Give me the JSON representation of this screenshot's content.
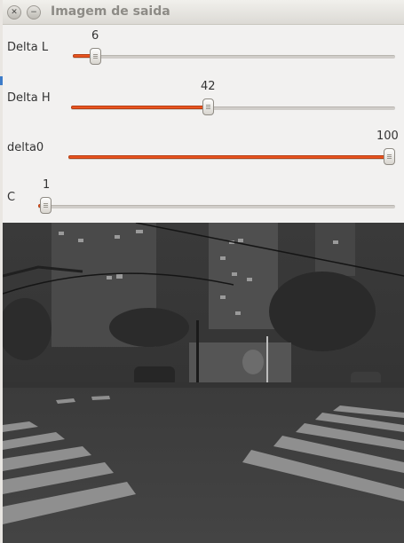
{
  "window": {
    "title": "Imagem de saida",
    "close_icon": "close-icon",
    "minimize_icon": "minimize-icon"
  },
  "sliders": [
    {
      "label": "Delta L",
      "value": "6",
      "max": 100,
      "level": 0.06
    },
    {
      "label": "Delta H",
      "value": "42",
      "max": 100,
      "level": 0.42
    },
    {
      "label": "delta0",
      "value": "100",
      "max": 100,
      "level": 1.0
    },
    {
      "label": "C",
      "value": "1",
      "max": 100,
      "level": 0.01
    }
  ],
  "colors": {
    "accent": "#e95420",
    "panel": "#f2f1f0",
    "titlebar": "#dcdad5"
  }
}
